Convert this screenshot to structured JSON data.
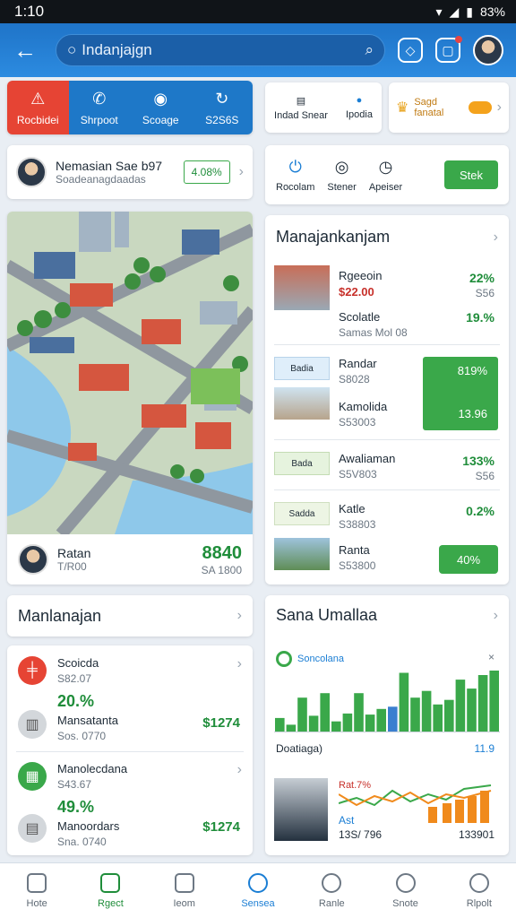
{
  "status": {
    "time": "1:10",
    "battery": "83%"
  },
  "search": {
    "query": "Indanjajgn"
  },
  "quick_actions": [
    {
      "label": "Rocbidei",
      "color": "#e64434",
      "icon": "warning-icon"
    },
    {
      "label": "Shrpoot",
      "color": "#1e78c8",
      "icon": "chat-icon"
    },
    {
      "label": "Scoage",
      "color": "#1e78c8",
      "icon": "camera-icon"
    },
    {
      "label": "S2S6S",
      "color": "#1e78c8",
      "icon": "refresh-icon"
    }
  ],
  "top_right_card": {
    "items": [
      "Indad Snear",
      "Ipodia"
    ],
    "promo": "Sagd fanatal"
  },
  "profile_card": {
    "name": "Nemasian Sae b97",
    "sub": "Soadeanagdaadas",
    "badge": "4.08%"
  },
  "tools_card": {
    "items": [
      "Rocolam",
      "Stener",
      "Apeiser"
    ],
    "button": "Stek"
  },
  "map_card": {
    "name": "Ratan",
    "sub": "T/R00",
    "value": "8840",
    "value_sub": "SA 1800"
  },
  "listings": {
    "title": "Manajankanjam",
    "items": [
      {
        "title": "Rgeeoin",
        "sub": "$22.00",
        "value": "22%",
        "value_sub": "S56"
      },
      {
        "title": "Scolatle",
        "sub": "Samas Mol 08",
        "value": "19.%",
        "value_sub": ""
      },
      {
        "title": "Randar",
        "sub": "S8028",
        "value": "819%",
        "value_sub": "",
        "thumb_label": "Badia"
      },
      {
        "title": "Kamolida",
        "sub": "S53003",
        "value": "13.96",
        "value_sub": ""
      },
      {
        "title": "Awaliaman",
        "sub": "S5V803",
        "value": "133%",
        "value_sub": "S56",
        "thumb_label": "Bada"
      },
      {
        "title": "Katle",
        "sub": "S38803",
        "value": "0.2%",
        "value_sub": "",
        "thumb_label": "Sadda"
      },
      {
        "title": "Ranta",
        "sub": "S53800",
        "value": "40%",
        "value_sub": ""
      }
    ]
  },
  "manlanajan": {
    "title": "Manlanajan"
  },
  "stats_card": {
    "items": [
      {
        "title": "Scoicda",
        "sub": "S82.07",
        "pct": "20.%",
        "name": "Mansatanta",
        "name_sub": "Sos. 0770",
        "value": "$1274"
      },
      {
        "title": "Manolecdana",
        "sub": "S43.67",
        "pct": "49.%",
        "name": "Manoordars",
        "name_sub": "Sna. 0740",
        "value": "$1274"
      }
    ]
  },
  "analytics": {
    "title": "Sana Umallaa",
    "legend": "Soncolana",
    "caption": "Doatiaga)",
    "caption_value": "11.9",
    "footer_a": "Ast",
    "footer_b": "13S/ 796",
    "footer_c": "133901",
    "footer_d": "Rat.7%"
  },
  "chart_data": {
    "type": "bar",
    "values": [
      12,
      6,
      30,
      14,
      34,
      9,
      16,
      34,
      15,
      20,
      22,
      52,
      30,
      36,
      24,
      28,
      46,
      38,
      50,
      54
    ],
    "highlight_index": 10,
    "colors": {
      "base": "#3aa84a",
      "highlight": "#3b7fd0"
    }
  },
  "bottom_nav": [
    {
      "label": "Hote",
      "icon": "home-icon"
    },
    {
      "label": "Rgect",
      "icon": "projects-icon"
    },
    {
      "label": "Ieom",
      "icon": "inbox-icon"
    },
    {
      "label": "Sensea",
      "icon": "info-icon"
    },
    {
      "label": "Ranle",
      "icon": "clock-icon"
    },
    {
      "label": "Snote",
      "icon": "notes-icon"
    },
    {
      "label": "Rlpolt",
      "icon": "profile-icon"
    }
  ]
}
